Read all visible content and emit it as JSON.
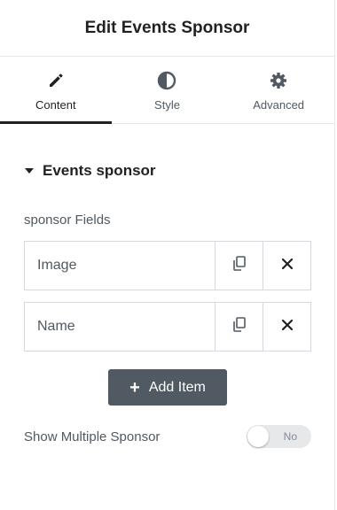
{
  "header": {
    "title": "Edit Events Sponsor"
  },
  "tabs": [
    {
      "label": "Content",
      "icon": "pencil-icon",
      "active": true
    },
    {
      "label": "Style",
      "icon": "contrast-icon",
      "active": false
    },
    {
      "label": "Advanced",
      "icon": "gear-icon",
      "active": false
    }
  ],
  "section": {
    "title": "Events sponsor"
  },
  "repeater": {
    "label": "sponsor Fields",
    "items": [
      {
        "title": "Image"
      },
      {
        "title": "Name"
      }
    ],
    "add_label": "Add Item"
  },
  "toggle": {
    "label": "Show Multiple Sponsor",
    "state_text": "No",
    "on": false
  },
  "colors": {
    "text": "#1f2124",
    "muted": "#515962",
    "button": "#515962",
    "border": "#d5d8dc"
  }
}
